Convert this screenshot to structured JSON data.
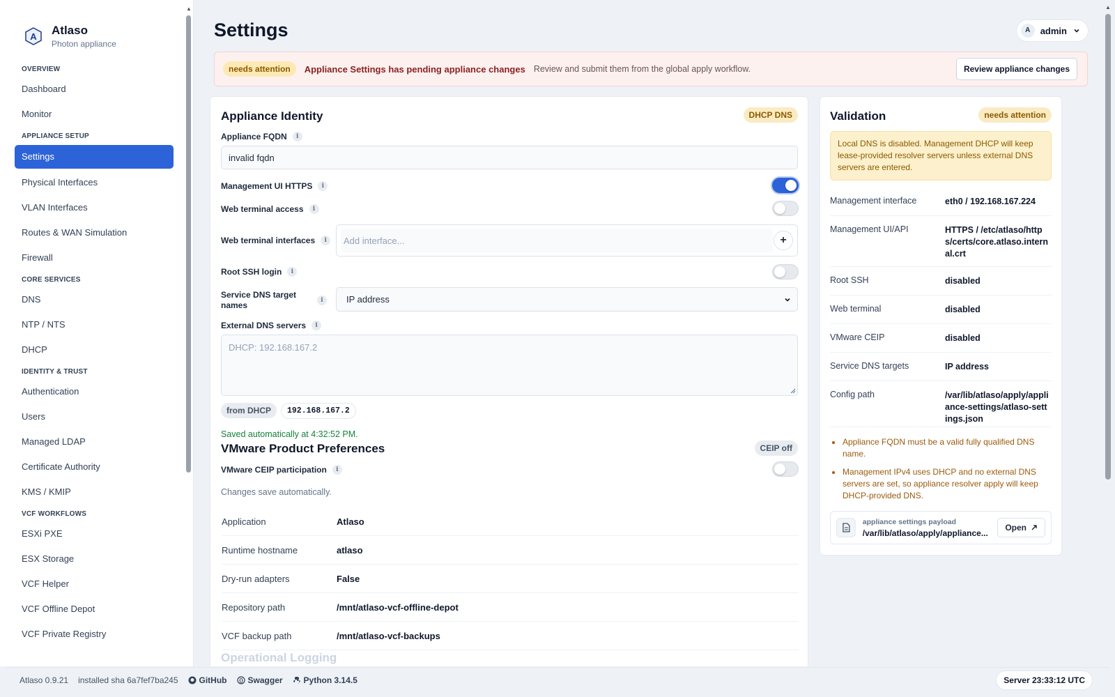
{
  "brand": {
    "name": "Atlaso",
    "subtitle": "Photon appliance"
  },
  "sidebar": {
    "sections": [
      {
        "title": "OVERVIEW",
        "items": [
          "Dashboard",
          "Monitor"
        ]
      },
      {
        "title": "APPLIANCE SETUP",
        "items": [
          "Settings",
          "Physical Interfaces",
          "VLAN Interfaces",
          "Routes & WAN Simulation",
          "Firewall"
        ]
      },
      {
        "title": "CORE SERVICES",
        "items": [
          "DNS",
          "NTP / NTS",
          "DHCP"
        ]
      },
      {
        "title": "IDENTITY & TRUST",
        "items": [
          "Authentication",
          "Users",
          "Managed LDAP",
          "Certificate Authority",
          "KMS / KMIP"
        ]
      },
      {
        "title": "VCF WORKFLOWS",
        "items": [
          "ESXi PXE",
          "ESX Storage",
          "VCF Helper",
          "VCF Offline Depot",
          "VCF Private Registry"
        ]
      }
    ],
    "active": "Settings"
  },
  "header": {
    "title": "Settings",
    "user_initial": "A",
    "user_name": "admin"
  },
  "alert": {
    "badge": "needs attention",
    "strong": "Appliance Settings has pending appliance changes",
    "text": "Review and submit them from the global apply workflow.",
    "button": "Review appliance changes"
  },
  "identity": {
    "title": "Appliance Identity",
    "pill": "DHCP DNS",
    "fqdn_label": "Appliance FQDN",
    "fqdn_value": "invalid fqdn",
    "https_label": "Management UI HTTPS",
    "https_on": true,
    "web_terminal_label": "Web terminal access",
    "web_terminal_on": false,
    "web_iface_label": "Web terminal interfaces",
    "web_iface_placeholder": "Add interface...",
    "root_ssh_label": "Root SSH login",
    "root_ssh_on": false,
    "dns_target_label": "Service DNS target names",
    "dns_target_value": "IP address",
    "ext_dns_label": "External DNS servers",
    "ext_dns_placeholder": "DHCP: 192.168.167.2",
    "chip_from": "from DHCP",
    "chip_ip": "192.168.167.2",
    "saved": "Saved automatically at 4:32:52 PM."
  },
  "vmware": {
    "title": "VMware Product Preferences",
    "pill": "CEIP off",
    "ceip_label": "VMware CEIP participation",
    "ceip_on": false,
    "note": "Changes save automatically.",
    "rows": [
      {
        "k": "Application",
        "v": "Atlaso"
      },
      {
        "k": "Runtime hostname",
        "v": "atlaso"
      },
      {
        "k": "Dry-run adapters",
        "v": "False"
      },
      {
        "k": "Repository path",
        "v": "/mnt/atlaso-vcf-offline-depot"
      },
      {
        "k": "VCF backup path",
        "v": "/mnt/atlaso-vcf-backups"
      }
    ],
    "next_section": "Operational Logging"
  },
  "validation": {
    "title": "Validation",
    "pill": "needs attention",
    "warning": "Local DNS is disabled. Management DHCP will keep lease-provided resolver servers unless external DNS servers are entered.",
    "rows": [
      {
        "k": "Management interface",
        "v": "eth0 / 192.168.167.224"
      },
      {
        "k": "Management UI/API",
        "v": "HTTPS / /etc/atlaso/https/certs/core.atlaso.internal.crt"
      },
      {
        "k": "Root SSH",
        "v": "disabled"
      },
      {
        "k": "Web terminal",
        "v": "disabled"
      },
      {
        "k": "VMware CEIP",
        "v": "disabled"
      },
      {
        "k": "Service DNS targets",
        "v": "IP address"
      },
      {
        "k": "Config path",
        "v": "/var/lib/atlaso/apply/appliance-settings/atlaso-settings.json"
      }
    ],
    "issues": [
      "Appliance FQDN must be a valid fully qualified DNS name.",
      "Management IPv4 uses DHCP and no external DNS servers are set, so appliance resolver apply will keep DHCP-provided DNS."
    ],
    "payload_label": "appliance settings payload",
    "payload_path": "/var/lib/atlaso/apply/appliance...",
    "open": "Open"
  },
  "footer": {
    "version": "Atlaso 0.9.21",
    "sha": "installed sha 6a7fef7ba245",
    "github": "GitHub",
    "swagger": "Swagger",
    "python": "Python 3.14.5",
    "server_time": "Server 23:33:12 UTC"
  },
  "colors": {
    "accent": "#2d63d8",
    "attention": "#fbebc2",
    "alert_bg": "#fdf1f0"
  }
}
